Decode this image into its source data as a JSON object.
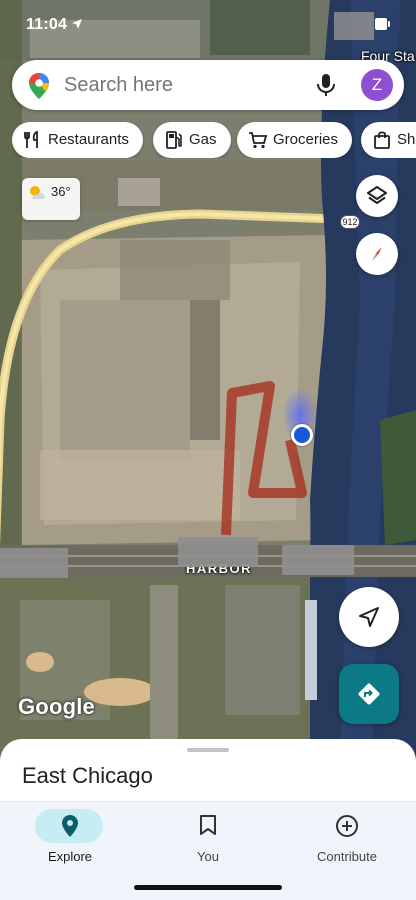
{
  "status_bar": {
    "time": "11:04"
  },
  "map": {
    "labels": {
      "corner_place": "Four Sta",
      "harbor": "HARBOR",
      "route_number": "912"
    },
    "attribution": "Google"
  },
  "search": {
    "placeholder": "Search here",
    "avatar_initial": "Z"
  },
  "chips": [
    {
      "label": "Restaurants",
      "icon": "fork-knife-icon"
    },
    {
      "label": "Gas",
      "icon": "gas-pump-icon"
    },
    {
      "label": "Groceries",
      "icon": "shopping-cart-icon"
    },
    {
      "label": "Sho",
      "icon": "shopping-bag-icon"
    }
  ],
  "weather": {
    "temperature": "36°",
    "icon": "partly-cloudy-icon"
  },
  "place_sheet": {
    "title": "East Chicago"
  },
  "bottom_nav": [
    {
      "label": "Explore",
      "icon": "explore-pin-icon",
      "active": true
    },
    {
      "label": "You",
      "icon": "bookmark-icon",
      "active": false
    },
    {
      "label": "Contribute",
      "icon": "add-circle-icon",
      "active": false
    }
  ],
  "colors": {
    "avatar": "#8e4fd1",
    "directions_button": "#0b7a86",
    "explore_pill": "#c6ecf4",
    "route_trace": "#a52a1a",
    "location_dot": "#1a57d6"
  }
}
